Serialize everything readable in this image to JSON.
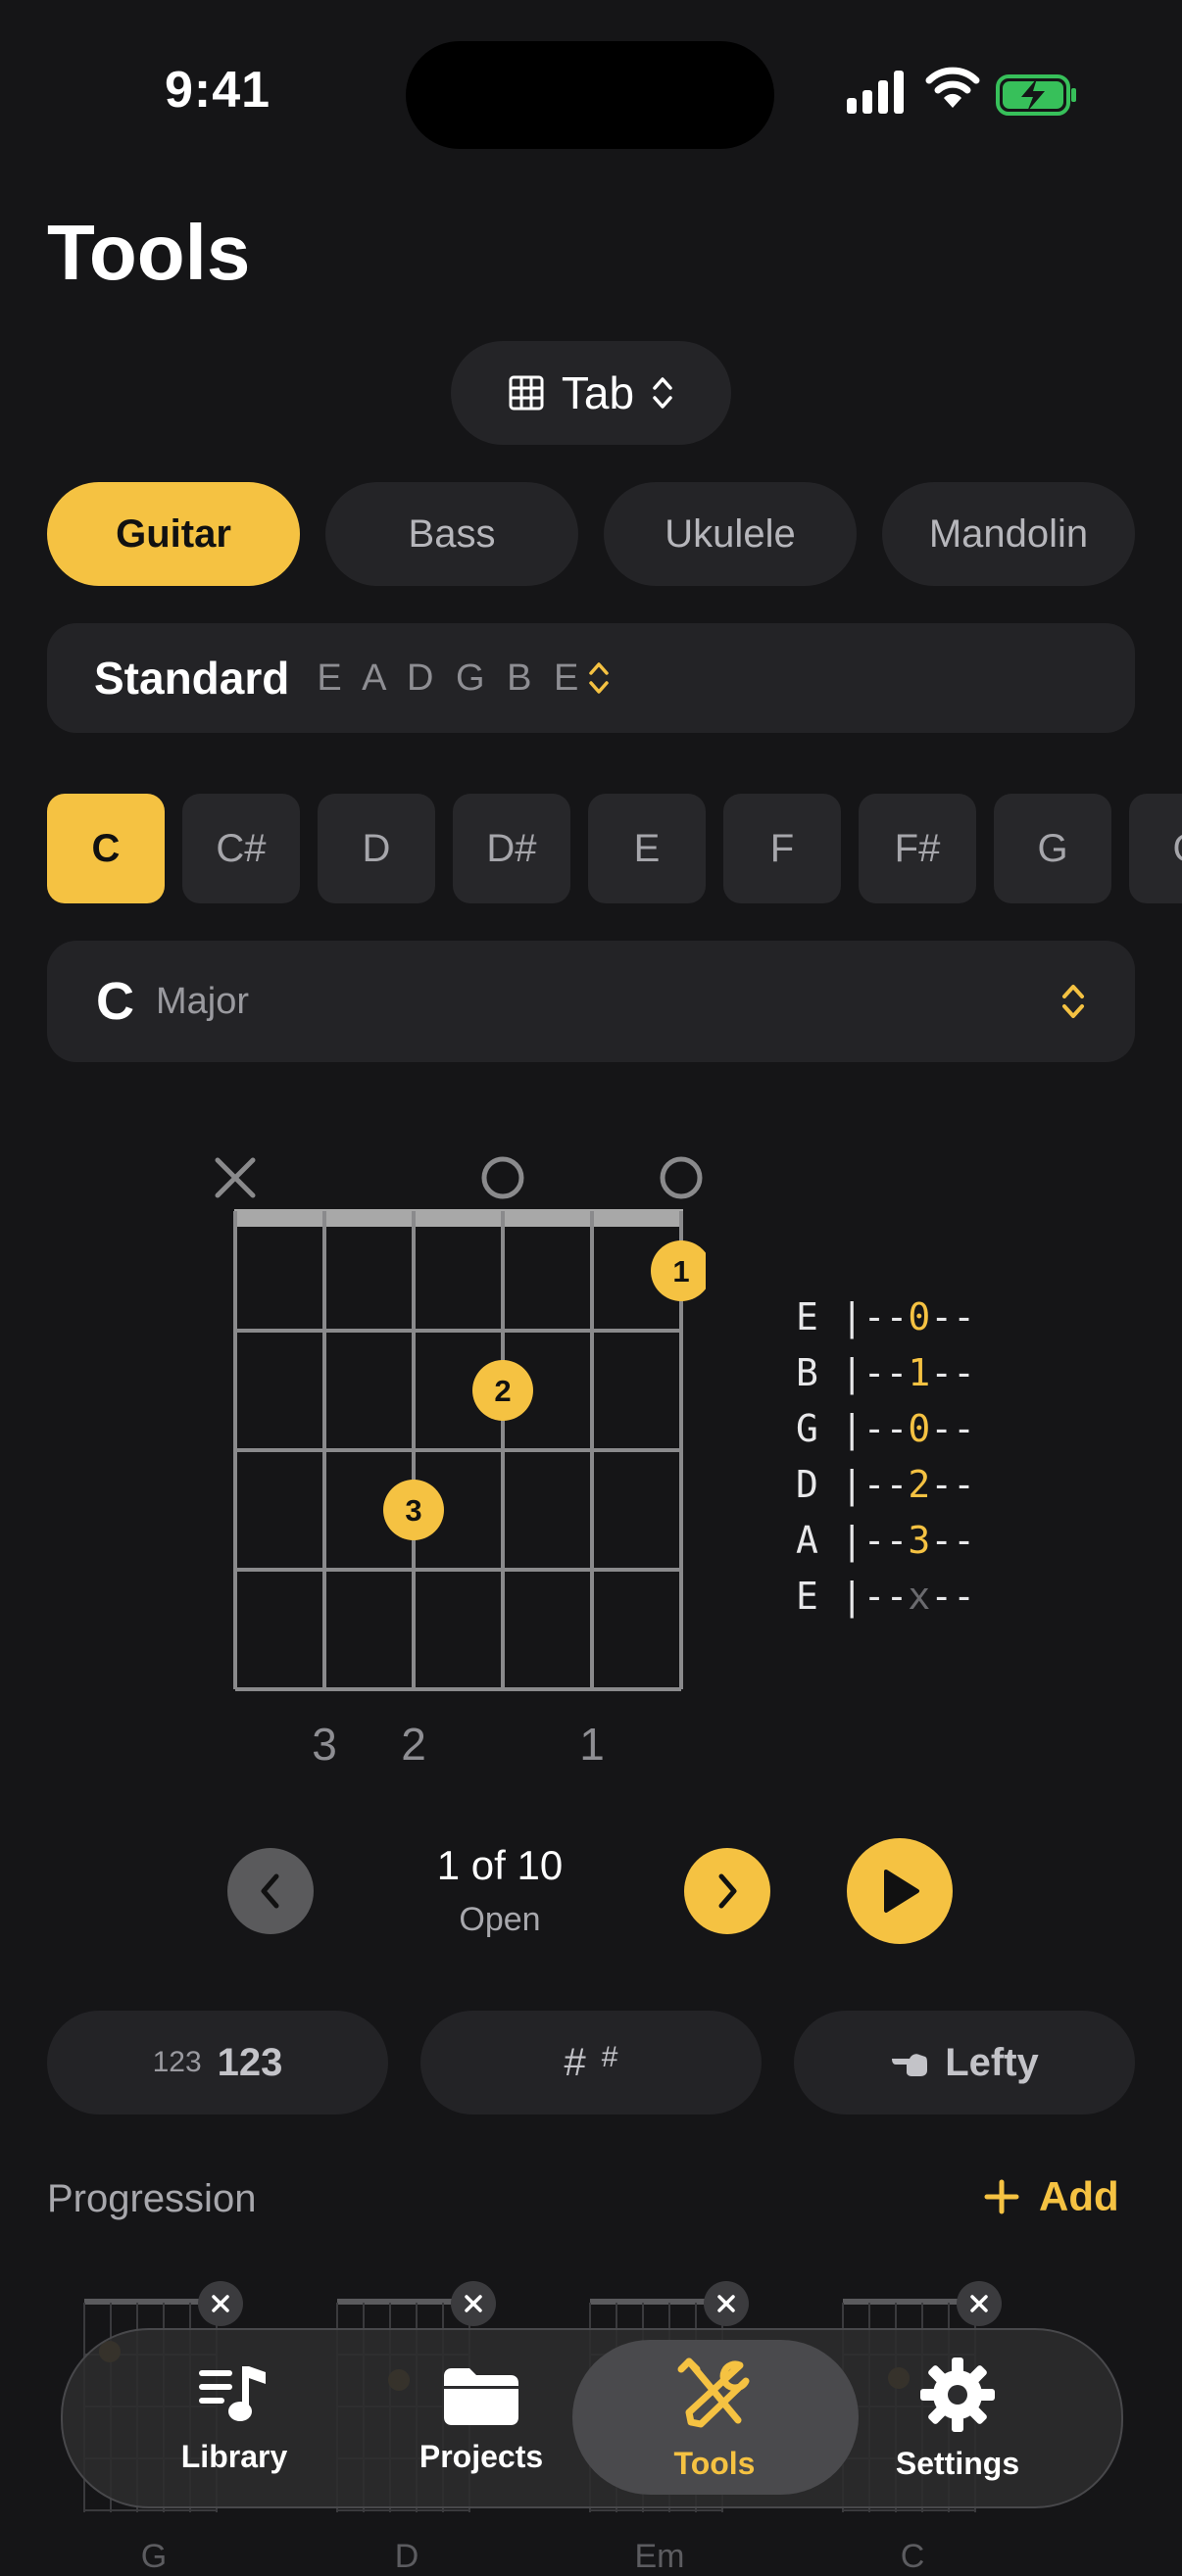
{
  "status": {
    "time": "9:41"
  },
  "page": {
    "title": "Tools"
  },
  "mode_picker": {
    "label": "Tab",
    "icon": "grid-icon"
  },
  "instruments": [
    {
      "label": "Guitar",
      "active": true
    },
    {
      "label": "Bass",
      "active": false
    },
    {
      "label": "Ukulele",
      "active": false
    },
    {
      "label": "Mandolin",
      "active": false
    }
  ],
  "tuning": {
    "name": "Standard",
    "notes": "E A D G B E"
  },
  "roots": [
    "C",
    "C#",
    "D",
    "D#",
    "E",
    "F",
    "F#",
    "G",
    "G"
  ],
  "selected_root": "C",
  "chord": {
    "root": "C",
    "quality": "Major"
  },
  "diagram": {
    "string_markers": [
      "×",
      "",
      "",
      "○",
      "",
      "○"
    ],
    "dots": [
      {
        "string": 5,
        "fret": 1,
        "finger": "1"
      },
      {
        "string": 3,
        "fret": 2,
        "finger": "2"
      },
      {
        "string": 2,
        "fret": 3,
        "finger": "3"
      }
    ],
    "finger_labels": [
      "",
      "3",
      "2",
      "",
      "1",
      ""
    ]
  },
  "tab": [
    {
      "string": "E",
      "fret": "0"
    },
    {
      "string": "B",
      "fret": "1"
    },
    {
      "string": "G",
      "fret": "0"
    },
    {
      "string": "D",
      "fret": "2"
    },
    {
      "string": "A",
      "fret": "3"
    },
    {
      "string": "E",
      "fret": "x"
    }
  ],
  "voicing": {
    "position": "1 of 10",
    "name": "Open"
  },
  "options": {
    "numbers": {
      "small": "123",
      "big": "123"
    },
    "accidental": {
      "big": "#",
      "small": "#"
    },
    "lefty": {
      "label": "Lefty"
    }
  },
  "progression": {
    "title": "Progression",
    "add_label": "Add",
    "items": [
      "G",
      "D",
      "Em",
      "C"
    ]
  },
  "tabbar": {
    "items": [
      {
        "label": "Library",
        "icon": "music-list-icon"
      },
      {
        "label": "Projects",
        "icon": "folder-icon"
      },
      {
        "label": "Tools",
        "icon": "tools-icon",
        "active": true
      },
      {
        "label": "Settings",
        "icon": "gear-icon"
      }
    ]
  },
  "colors": {
    "accent": "#f5c242",
    "background": "#151517",
    "surface": "#232326"
  }
}
